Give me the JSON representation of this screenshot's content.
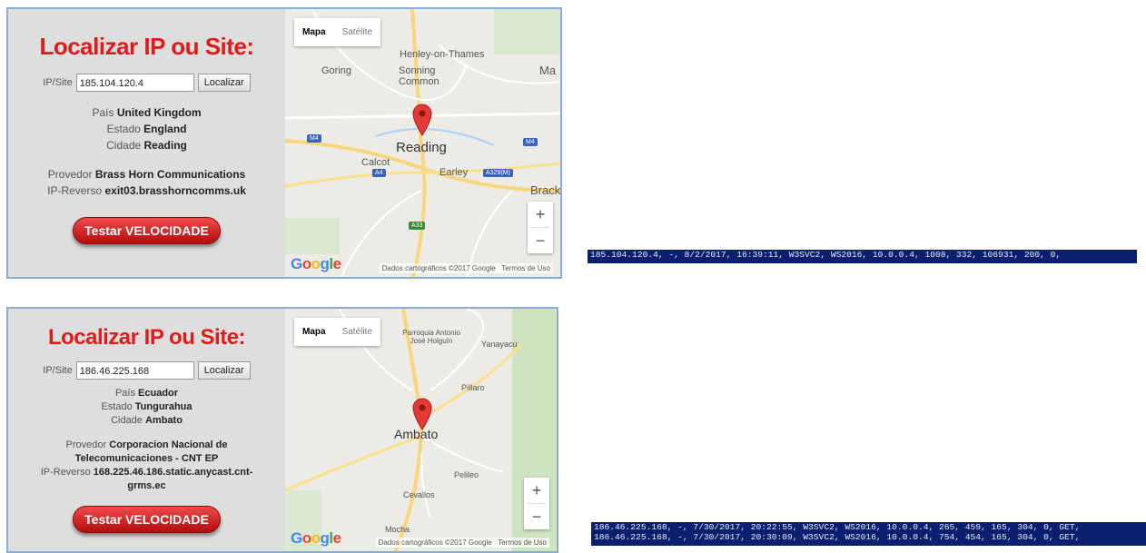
{
  "panels": [
    {
      "title": "Localizar IP ou Site:",
      "ip_label": "IP/Site",
      "ip_value": "185.104.120.4",
      "locate_button": "Localizar",
      "country_label": "País",
      "country": "United Kingdom",
      "state_label": "Estado",
      "state": "England",
      "city_label": "Cidade",
      "city": "Reading",
      "provider_label": "Provedor",
      "provider": "Brass Horn Communications",
      "reverse_label": "IP-Reverso",
      "reverse": "exit03.brasshorncomms.uk",
      "speed_button": "Testar VELOCIDADE",
      "map": {
        "tab_map": "Mapa",
        "tab_satellite": "Satélite",
        "city_label": "Reading",
        "labels": [
          "Henley-on-Thames",
          "Goring",
          "Sonning Common",
          "Ma",
          "Calcot",
          "Earley",
          "Brack"
        ],
        "road_shields": [
          "M4",
          "M4",
          "A4",
          "A329(M)",
          "A33"
        ],
        "attribution": "Dados cartográficos ©2017 Google",
        "terms": "Termos de Uso",
        "zoom_in": "+",
        "zoom_out": "−"
      }
    },
    {
      "title": "Localizar IP ou Site:",
      "ip_label": "IP/Site",
      "ip_value": "186.46.225.168",
      "locate_button": "Localizar",
      "country_label": "País",
      "country": "Ecuador",
      "state_label": "Estado",
      "state": "Tungurahua",
      "city_label": "Cidade",
      "city": "Ambato",
      "provider_label": "Provedor",
      "provider_line1": "Corporacion Nacional de",
      "provider_line2": "Telecomunicaciones - CNT EP",
      "reverse_label": "IP-Reverso",
      "reverse_line1": "168.225.46.186.static.anycast.cnt-",
      "reverse_line2": "grms.ec",
      "speed_button": "Testar VELOCIDADE",
      "map": {
        "tab_map": "Mapa",
        "tab_satellite": "Satélite",
        "city_label": "Ambato",
        "labels": [
          "Parroquia Antonio José Holguín",
          "Yanayacu",
          "Píllaro",
          "Pelileo",
          "Cevallos",
          "Mocha"
        ],
        "attribution": "Dados cartográficos ©2017 Google",
        "terms": "Termos de Uso",
        "zoom_in": "+",
        "zoom_out": "−"
      }
    }
  ],
  "logs": {
    "first": "185.104.120.4, -, 8/2/2017, 16:39:11, W3SVC2, WS2016, 10.0.0.4, 1008, 332, 106931, 200, 0,",
    "second_line1": "186.46.225.168, -, 7/30/2017, 20:22:55, W3SVC2, WS2016, 10.0.0.4, 265, 459, 165, 304, 0, GET,",
    "second_line2": "186.46.225.168, -, 7/30/2017, 20:30:09, W3SVC2, WS2016, 10.0.0.4, 754, 454, 165, 304, 0, GET,"
  },
  "colors": {
    "title_red": "#e01b1b",
    "panel_border": "#8aaed0",
    "log_background": "#0a1f6e",
    "pin_red": "#e53935"
  }
}
